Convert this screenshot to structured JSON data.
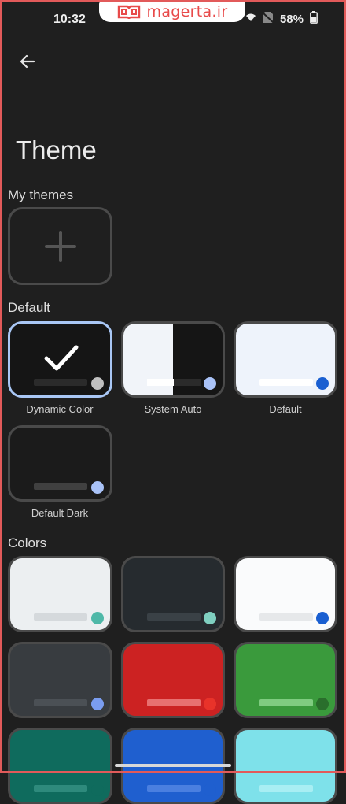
{
  "status": {
    "time": "10:32",
    "battery": "58%"
  },
  "watermark": {
    "text": "magerta.ir"
  },
  "header": {
    "title": "Theme"
  },
  "sections": {
    "my_themes": "My themes",
    "default": "Default",
    "colors": "Colors"
  },
  "default_themes": [
    {
      "label": "Dynamic Color",
      "selected": true,
      "bg": "#151515",
      "bar": "#2b2b2b",
      "dot": "#bfbfbf"
    },
    {
      "label": "System Auto",
      "bg_left": "#f1f4f9",
      "bg_right": "#151515",
      "bar": "#ffffff",
      "bar_right": "#2b2b2b",
      "dot": "#a9c2f7"
    },
    {
      "label": "Default",
      "bg": "#eef3fb",
      "bar": "#ffffff",
      "dot": "#1a5fd1"
    },
    {
      "label": "Default Dark",
      "bg": "#1b1b1b",
      "bar": "#404040",
      "dot": "#a9c2f7"
    }
  ],
  "color_themes": [
    {
      "bg": "#eceff1",
      "bar": "#d5d9dc",
      "dot": "#4fb8a8"
    },
    {
      "bg": "#262b2f",
      "bar": "#3a4146",
      "dot": "#7fcfc0"
    },
    {
      "bg": "#fafbfc",
      "bar": "#e6e8ea",
      "dot": "#1a5fd1"
    },
    {
      "bg": "#383c40",
      "bar": "#4b5055",
      "dot": "#7a9df0"
    },
    {
      "bg": "#cc2222",
      "bar": "#e87070",
      "dot": "#e8332a"
    },
    {
      "bg": "#3a9a3c",
      "bar": "#7fcc80",
      "dot": "#2a6e2c"
    },
    {
      "bg": "#0f6b5d",
      "bar": "#2e8a7c",
      "dot": "#0f6b5d"
    },
    {
      "bg": "#1f5fcf",
      "bar": "#4a7fe0",
      "dot": "#1f5fcf"
    },
    {
      "bg": "#7ee1ea",
      "bar": "#a8eef3",
      "dot": "#7ee1ea"
    }
  ],
  "colors": {
    "frame": "#e25a5a",
    "selected_border": "#a9c7f5",
    "card_border": "#4a4a4a"
  }
}
